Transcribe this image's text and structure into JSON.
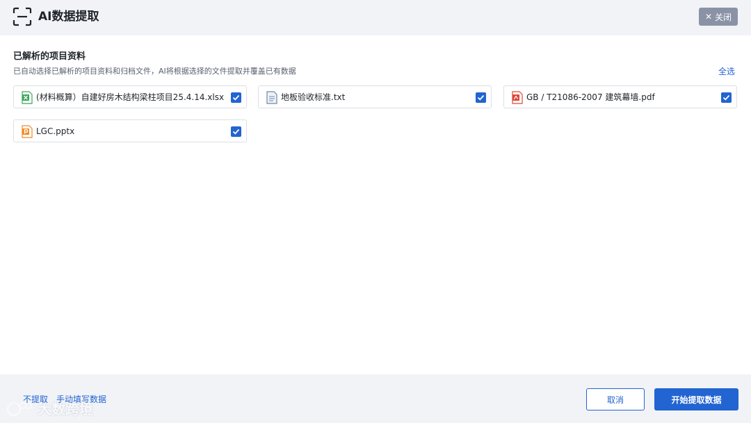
{
  "header": {
    "title": "AI数据提取",
    "close_label": "关闭",
    "icon": "scan-icon"
  },
  "section": {
    "title": "已解析的项目资料",
    "description": "已自动选择已解析的项目资料和归档文件，AI将根据选择的文件提取并覆盖已有数据",
    "select_all_label": "全选"
  },
  "files": [
    {
      "name": "(材料概算）自建好房木结构梁柱项目25.4.14.xlsx",
      "type": "xlsx",
      "checked": true,
      "icon": "excel-file-icon"
    },
    {
      "name": "地板验收标准.txt",
      "type": "txt",
      "checked": true,
      "icon": "text-file-icon"
    },
    {
      "name": "GB / T21086-2007 建筑幕墙.pdf",
      "type": "pdf",
      "checked": true,
      "icon": "pdf-file-icon"
    },
    {
      "name": "LGC.pptx",
      "type": "pptx",
      "checked": true,
      "icon": "ppt-file-icon"
    }
  ],
  "footer": {
    "skip_label": "不提取",
    "manual_label": "手动填写数据",
    "cancel_label": "取消",
    "start_label": "开始提取数据",
    "watermark": "大数跨境"
  },
  "colors": {
    "accent": "#2264d1",
    "excel": "#3aa55c",
    "pdf": "#e0463c",
    "ppt": "#f08a24",
    "txt": "#6f86a8"
  }
}
